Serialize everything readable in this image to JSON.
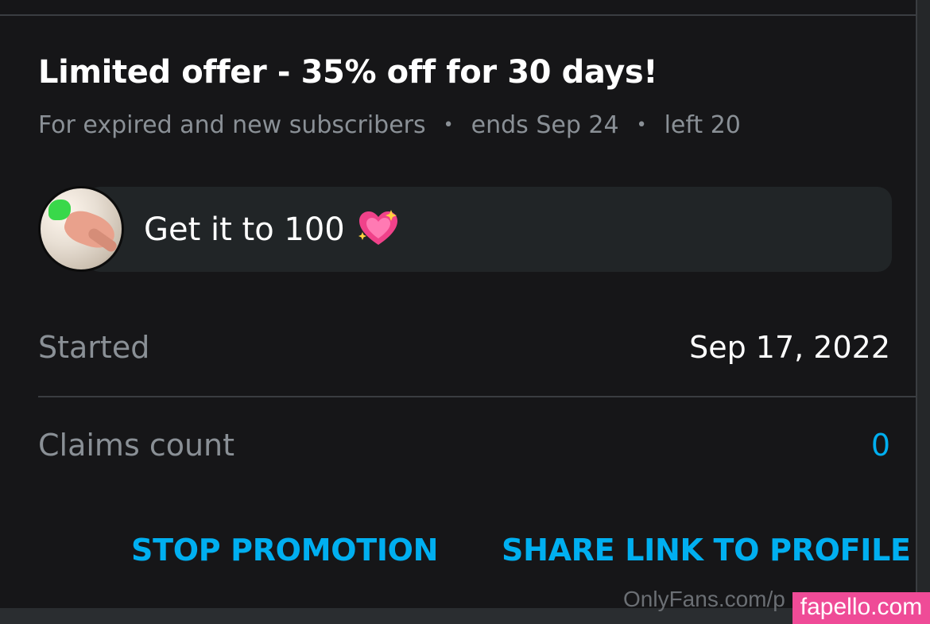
{
  "offer": {
    "title": "Limited offer - 35% off for 30 days!",
    "audience": "For expired and new subscribers",
    "ends": "ends Sep 24",
    "left": "left 20",
    "separator": "•"
  },
  "message": {
    "text": "Get it to 100",
    "emoji_icon": "sparkling-heart-icon"
  },
  "details": {
    "started_label": "Started",
    "started_value": "Sep 17, 2022",
    "claims_label": "Claims count",
    "claims_value": "0"
  },
  "actions": {
    "stop_label": "STOP PROMOTION",
    "share_label": "SHARE LINK TO PROFILE"
  },
  "watermark": {
    "onlyfans_text": "OnlyFans.com/p",
    "badge_text": "fapello.com"
  },
  "colors": {
    "background": "#161618",
    "accent": "#00aff0",
    "muted_text": "#8a9096",
    "bubble": "#212527",
    "badge": "#ef4b97"
  }
}
